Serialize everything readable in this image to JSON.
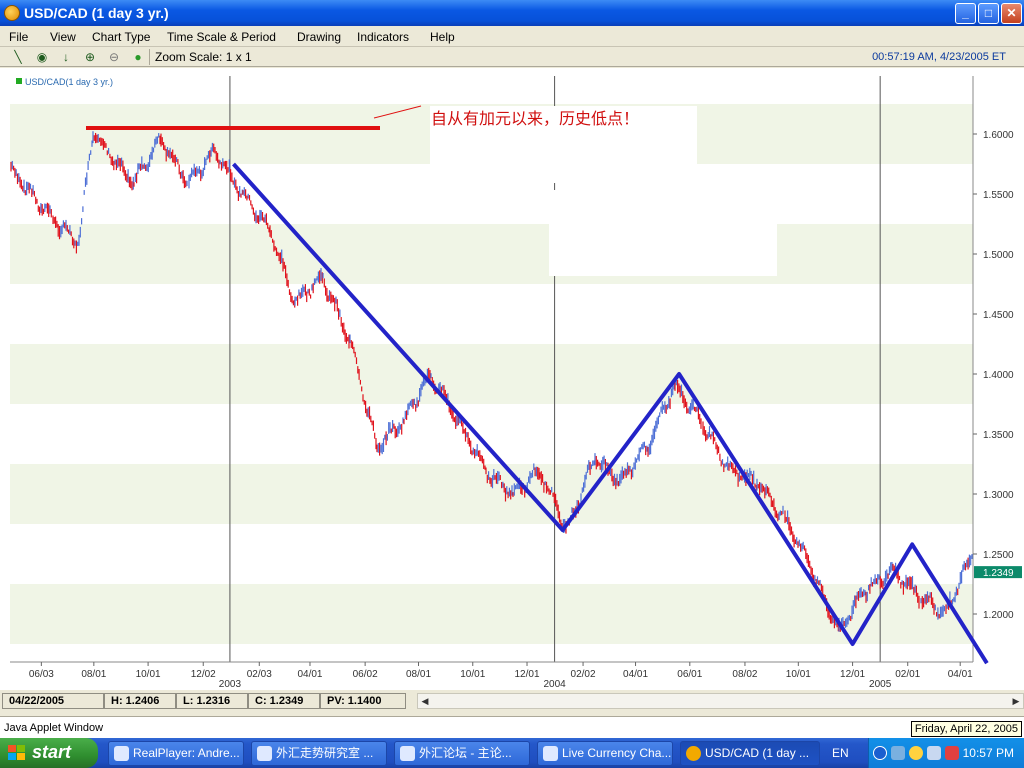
{
  "window": {
    "title": "USD/CAD (1 day  3 yr.)",
    "buttons": [
      "minimize",
      "maximize",
      "close"
    ]
  },
  "menu": [
    "File",
    "View",
    "Chart Type",
    "Time Scale & Period",
    "Drawing",
    "Indicators",
    "Help"
  ],
  "toolbar": {
    "icons": [
      "line-tool-icon",
      "crosshair-icon",
      "arrow-down-icon",
      "zoom-in-icon",
      "zoom-out-icon",
      "globe-icon"
    ],
    "zoom_label": "Zoom Scale: 1 x 1",
    "clock": "00:57:19 AM, 4/23/2005 ET"
  },
  "chart_data": {
    "type": "candlestick",
    "series_label": "USD/CAD(1 day  3 yr.)",
    "annotation": "自从有加元以来，历史低点！",
    "ylim": [
      1.15,
      1.65
    ],
    "y_ticks": [
      "1.6000",
      "1.5500",
      "1.5000",
      "1.4500",
      "1.4000",
      "1.3500",
      "1.3000",
      "1.2500",
      "1.2000"
    ],
    "x_ticks": [
      "06/03",
      "08/01",
      "10/01",
      "12/02",
      "02/03",
      "04/01",
      "06/02",
      "08/01",
      "10/01",
      "12/01",
      "02/02",
      "04/01",
      "06/01",
      "08/02",
      "10/01",
      "12/01",
      "02/01",
      "04/01"
    ],
    "year_labels": [
      "2003",
      "2004",
      "2005"
    ],
    "last_price": "1.2349",
    "price_path": [
      {
        "date": "2002-05",
        "value": 1.57
      },
      {
        "date": "2002-06",
        "value": 1.53
      },
      {
        "date": "2002-07",
        "value": 1.51
      },
      {
        "date": "2002-07",
        "value": 1.6
      },
      {
        "date": "2002-09",
        "value": 1.56
      },
      {
        "date": "2002-10",
        "value": 1.595
      },
      {
        "date": "2002-11",
        "value": 1.56
      },
      {
        "date": "2002-12",
        "value": 1.585
      },
      {
        "date": "2003-01",
        "value": 1.55
      },
      {
        "date": "2003-02",
        "value": 1.52
      },
      {
        "date": "2003-03",
        "value": 1.46
      },
      {
        "date": "2003-04",
        "value": 1.48
      },
      {
        "date": "2003-05",
        "value": 1.43
      },
      {
        "date": "2003-06",
        "value": 1.34
      },
      {
        "date": "2003-07",
        "value": 1.36
      },
      {
        "date": "2003-08",
        "value": 1.4
      },
      {
        "date": "2003-09",
        "value": 1.36
      },
      {
        "date": "2003-10",
        "value": 1.32
      },
      {
        "date": "2003-11",
        "value": 1.3
      },
      {
        "date": "2003-12",
        "value": 1.32
      },
      {
        "date": "2004-01",
        "value": 1.27
      },
      {
        "date": "2004-02",
        "value": 1.33
      },
      {
        "date": "2004-03",
        "value": 1.31
      },
      {
        "date": "2004-04",
        "value": 1.34
      },
      {
        "date": "2004-05",
        "value": 1.39
      },
      {
        "date": "2004-06",
        "value": 1.36
      },
      {
        "date": "2004-07",
        "value": 1.32
      },
      {
        "date": "2004-08",
        "value": 1.31
      },
      {
        "date": "2004-09",
        "value": 1.28
      },
      {
        "date": "2004-10",
        "value": 1.24
      },
      {
        "date": "2004-11",
        "value": 1.185
      },
      {
        "date": "2004-12",
        "value": 1.22
      },
      {
        "date": "2005-01",
        "value": 1.235
      },
      {
        "date": "2005-02",
        "value": 1.215
      },
      {
        "date": "2005-03",
        "value": 1.2
      },
      {
        "date": "2005-04",
        "value": 1.25
      },
      {
        "date": "2005-04",
        "value": 1.235
      }
    ],
    "trendlines": [
      {
        "color": "#2323c8",
        "points": [
          {
            "date": "2003-01",
            "value": 1.575
          },
          {
            "date": "2004-01",
            "value": 1.27
          },
          {
            "date": "2004-05",
            "value": 1.4
          },
          {
            "date": "2004-12",
            "value": 1.175
          },
          {
            "date": "2005-02",
            "value": 1.258
          },
          {
            "date": "2005-04",
            "value": 1.159
          }
        ]
      }
    ],
    "resistance_line": {
      "color": "#e01010",
      "value": 1.605
    }
  },
  "status": {
    "date": "04/22/2005",
    "high": "H: 1.2406",
    "low": "L: 1.2316",
    "close": "C: 1.2349",
    "pv": "PV: 1.1400"
  },
  "applet": {
    "label": "Java Applet Window",
    "date_tip": "Friday, April 22, 2005"
  },
  "taskbar": {
    "start": "start",
    "tasks": [
      "RealPlayer: Andre...",
      "外汇走势研究室 ...",
      "外汇论坛 - 主论...",
      "Live Currency Cha...",
      "USD/CAD (1 day ..."
    ],
    "lang": "EN",
    "clock": "10:57 PM"
  }
}
